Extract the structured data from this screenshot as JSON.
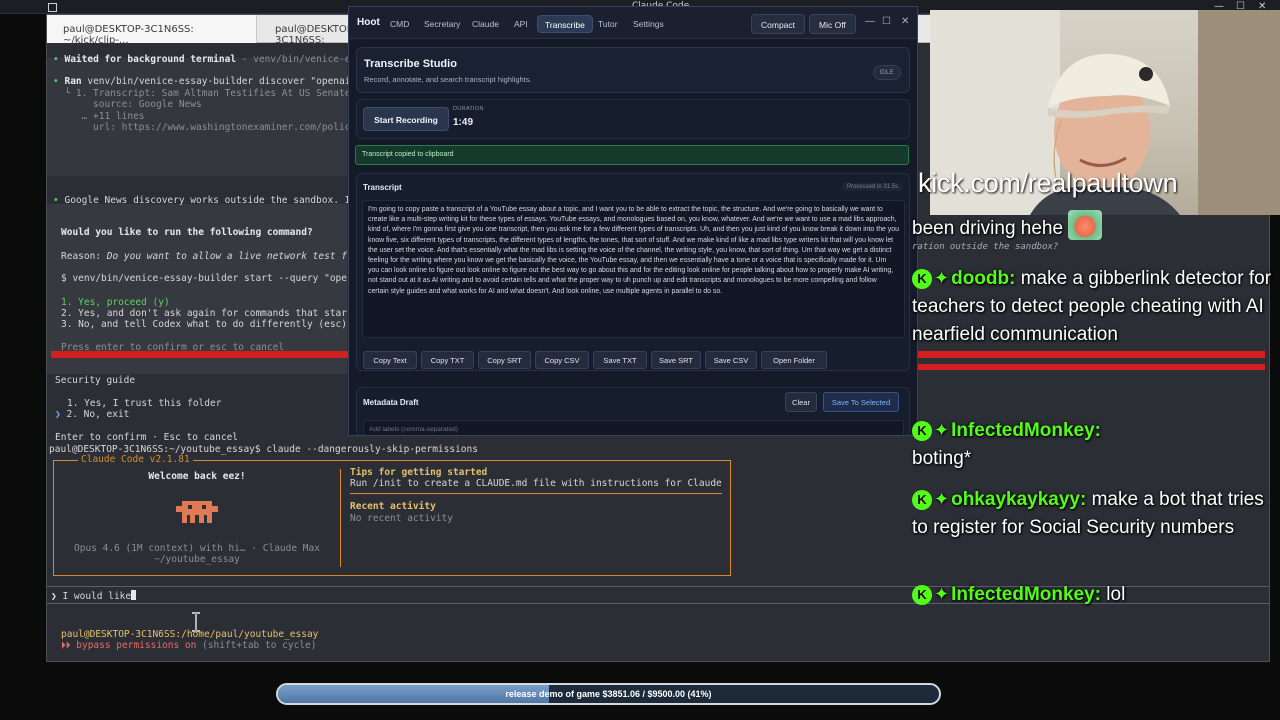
{
  "desktop": {
    "window_title": "Claude Code"
  },
  "terminal": {
    "tabs": [
      "paul@DESKTOP-3C1N6SS: ~/kick/clip-...",
      "paul@DESKTOP-3C1N6SS:"
    ],
    "lines": {
      "waited_prefix": "Waited for background terminal",
      "waited_rest": " - venv/bin/venice-e",
      "ran_prefix": "Ran",
      "ran_cmd": " venv/bin/venice-essay-builder discover \"openai",
      "res1": "  └ 1. Transcript: Sam Altman Testifies At US Senate",
      "res2": "       source: Google News",
      "res3": "     … +11 lines",
      "res4": "       url: https://www.washingtonexaminer.com/polic",
      "gnews": "Google News discovery works outside the sandbox. I",
      "would": "Would you like to run the following command?",
      "reason_label": "Reason:",
      "reason_text": " Do you want to allow a live network test f",
      "cmd_line": "$ venv/bin/venice-essay-builder start --query \"ope",
      "opt1": "1. Yes, proceed (y)",
      "opt2": "2. Yes, and don't ask again for commands that star",
      "opt3": "3. No, and tell Codex what to do differently (esc)",
      "press": "Press enter to confirm or esc to cancel",
      "sec_guide": "Security guide",
      "trust1": "1. Yes, I trust this folder",
      "trust2": "2. No, exit",
      "enter_confirm": "Enter to confirm · Esc to cancel",
      "claude_cmd": "paul@DESKTOP-3C1N6SS:~/youtube_essay$ claude --dangerously-skip-permissions"
    },
    "claude_box": {
      "legend": "Claude Code v2.1.81",
      "welcome": "Welcome back eez!",
      "model": "Opus 4.6 (1M context) with hi… · Claude Max",
      "dir": "~/youtube_essay",
      "tips_title": "Tips for getting started",
      "tips_text": "Run /init to create a CLAUDE.md file with instructions for Claude",
      "recent_title": "Recent activity",
      "recent_text": "No recent activity"
    },
    "prompt_text": "I would like",
    "status_path": "paul@DESKTOP-3C1N6SS:/home/paul/youtube_essay",
    "bypass_text": "bypass permissions on",
    "bypass_hint": " (shift+tab to cycle)"
  },
  "hoot": {
    "brand": "Hoot",
    "tabs": [
      "CMD",
      "Secretary",
      "Claude",
      "API",
      "Transcribe",
      "Tutor",
      "Settings"
    ],
    "active_tab": "Transcribe",
    "compact_label": "Compact",
    "mic_label": "Mic Off",
    "studio_title": "Transcribe Studio",
    "studio_subtitle": "Record, annotate, and search transcript highlights.",
    "status_badge": "IDLE",
    "record_button": "Start Recording",
    "duration_label": "DURATION",
    "duration_value": "1:49",
    "toast": "Transcript copied to clipboard",
    "transcript_title": "Transcript",
    "processed": "Processed in 31.5s",
    "transcript_text": "I'm going to copy paste a transcript of a YouTube essay about a topic, and I want you to be able to extract the topic, the structure. And we're going to basically we want to create like a multi-step writing kit for these types of essays. YouTube essays, and monologues based on, you know, whatever. And we're we want to use a mad libs approach, kind of, where I'm gonna first give you one transcript, then you ask me for a few different types of transcripts. Uh, and then you just kind of you know break it down into the you know five, six different types of transcripts, the different types of lengths, the tones, that sort of stuff. And we make kind of like a mad libs type writers kit that will you know let the user set the voice. And that's essentially what the mad libs is setting the voice of the channel, the writing style, you know, that sort of thing. Um that way we get a distinct feeling for the writing where you know we get the basically the voice, the YouTube essay, and then we essentially have a tone or a voice that is specifically made for it. Um you can look online to figure out look online to figure out the best way to go about this and for the editing look online for people talking about how to properly make AI writing, not stand out at it as AI writing and to avoid certain tells and what the proper way to uh punch up and edit transcripts and monologues to be more compelling and follow certain style guides and what works for AI and what doesn't. And look online, use multiple agents in parallel to do so.",
    "actions": [
      "Copy Text",
      "Copy TXT",
      "Copy SRT",
      "Copy CSV",
      "Save TXT",
      "Save SRT",
      "Save CSV",
      "Open Folder"
    ],
    "metadata_title": "Metadata Draft",
    "clear_label": "Clear",
    "save_selected_label": "Save To Selected",
    "labels_placeholder": "Add labels (comma-separated)"
  },
  "stream": {
    "kick_url": "kick.com/realpaultown",
    "chat": [
      {
        "user": "",
        "text": "been driving hehe",
        "emote": true,
        "sub": "ration outside the sandbox?"
      },
      {
        "user": "doodb:",
        "text": "make a gibberlink detector for teachers to detect people cheating with AI nearfield communication"
      },
      {
        "user": "InfectedMonkey:",
        "text": "boting*"
      },
      {
        "user": "ohkaykaykayy:",
        "text": "make a bot that tries to register for Social Security numbers"
      },
      {
        "user": "InfectedMonkey:",
        "text": "lol"
      }
    ],
    "badge_glyph": "K",
    "star_glyph": "✦",
    "goal_text": "release demo of game $3851.06 / $9500.00 (41%)",
    "goal_fraction": 0.41
  },
  "colors": {
    "kick_green": "#53fc18",
    "accent_orange": "#d98a2c",
    "hoot_bg": "#141a27",
    "terminal_bg": "#2b2f35"
  }
}
